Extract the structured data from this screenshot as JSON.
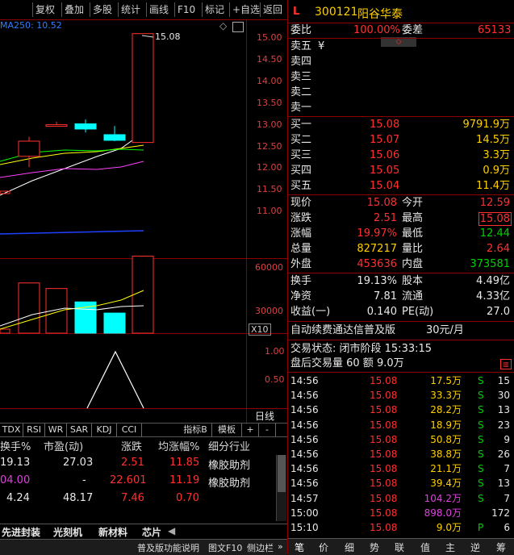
{
  "toolbar": {
    "items": [
      "复权",
      "叠加",
      "多股",
      "统计",
      "画线",
      "F10",
      "标记",
      "+自选",
      "返回"
    ]
  },
  "chart": {
    "indicator_label": "MA250: 10.52",
    "last_price_label": "15.08",
    "price_axis": [
      "15.00",
      "14.50",
      "14.00",
      "13.50",
      "13.00",
      "12.50",
      "12.00",
      "11.50",
      "11.00"
    ],
    "volume_axis": [
      "60000",
      "30000"
    ],
    "volume_unit": "X10",
    "osc_axis": [
      "1.00",
      "0.50"
    ],
    "period_label": "日线"
  },
  "chart_data": {
    "type": "candlestick",
    "candles": [
      {
        "open": 12.25,
        "close": 12.6,
        "high": 12.7,
        "low": 12.0
      },
      {
        "open": 12.98,
        "close": 12.98,
        "high": 13.05,
        "low": 12.95
      },
      {
        "open": 13.0,
        "close": 12.88,
        "high": 13.1,
        "low": 12.8
      },
      {
        "open": 12.75,
        "close": 12.62,
        "high": 12.95,
        "low": 12.6
      },
      {
        "open": 12.57,
        "close": 15.08,
        "high": 15.08,
        "low": 12.57
      }
    ],
    "volumes": [
      45000,
      40000,
      28000,
      18000,
      69000
    ],
    "osc": [
      0,
      1.0,
      0
    ]
  },
  "indicator_tabs": [
    "TDX",
    "RSI",
    "WR",
    "SAR",
    "KDJ",
    "CCI",
    "指标B",
    "模板",
    "+",
    "-"
  ],
  "table": {
    "headers": [
      "换手%",
      "市盈(动)",
      "涨跌",
      "均涨幅%",
      "细分行业"
    ],
    "rows": [
      [
        "19.13",
        "27.03",
        "2.51",
        "11.85",
        "橡胶助剂"
      ],
      [
        "04.00",
        "-",
        "22.601",
        "11.19",
        "橡胶助剂"
      ],
      [
        "4.24",
        "48.17",
        "7.46",
        "0.70",
        ""
      ]
    ]
  },
  "bottom_tabs": [
    "先进封装",
    "光刻机",
    "新材料",
    "芯片"
  ],
  "status_bar": {
    "left": "普及版功能说明",
    "items": [
      "图文F10",
      "侧边栏",
      "»"
    ]
  },
  "quote": {
    "flag": "L",
    "code": "300121",
    "name": "阳谷华泰",
    "weibi_label": "委比",
    "weibi_value": "100.00%",
    "weicha_label": "委差",
    "weicha_value": "65133",
    "asks": [
      {
        "label": "卖五",
        "price": "¥",
        "vol": ""
      },
      {
        "label": "卖四",
        "price": "",
        "vol": ""
      },
      {
        "label": "卖三",
        "price": "",
        "vol": ""
      },
      {
        "label": "卖二",
        "price": "",
        "vol": ""
      },
      {
        "label": "卖一",
        "price": "",
        "vol": ""
      }
    ],
    "bids": [
      {
        "label": "买一",
        "price": "15.08",
        "vol": "9791.9万"
      },
      {
        "label": "买二",
        "price": "15.07",
        "vol": "14.5万"
      },
      {
        "label": "买三",
        "price": "15.06",
        "vol": "3.3万"
      },
      {
        "label": "买四",
        "price": "15.05",
        "vol": "0.9万"
      },
      {
        "label": "买五",
        "price": "15.04",
        "vol": "11.4万"
      }
    ],
    "stats": [
      {
        "l1": "现价",
        "v1": "15.08",
        "l2": "今开",
        "v2": "12.59"
      },
      {
        "l1": "涨跌",
        "v1": "2.51",
        "l2": "最高",
        "v2": "15.08"
      },
      {
        "l1": "涨幅",
        "v1": "19.97%",
        "l2": "最低",
        "v2": "12.44"
      },
      {
        "l1": "总量",
        "v1": "827217",
        "l2": "量比",
        "v2": "2.64"
      },
      {
        "l1": "外盘",
        "v1": "453636",
        "l2": "内盘",
        "v2": "373581"
      }
    ],
    "stats2": [
      {
        "l1": "换手",
        "v1": "19.13%",
        "l2": "股本",
        "v2": "4.49亿"
      },
      {
        "l1": "净资",
        "v1": "7.81",
        "l2": "流通",
        "v2": "4.33亿"
      },
      {
        "l1": "收益(一)",
        "v1": "0.140",
        "l2": "PE(动)",
        "v2": "27.0"
      }
    ],
    "promo": "自动续费通达信普及版",
    "promo_price": "30元/月",
    "trade_status": "交易状态: 闭市阶段 15:33:15",
    "after_hours": "盘后交易量 60 额 9.0万",
    "ticks": [
      {
        "t": "14:56",
        "p": "15.08",
        "v": "17.5万",
        "s": "S",
        "n": "15"
      },
      {
        "t": "14:56",
        "p": "15.08",
        "v": "33.3万",
        "s": "S",
        "n": "30"
      },
      {
        "t": "14:56",
        "p": "15.08",
        "v": "28.2万",
        "s": "S",
        "n": "13"
      },
      {
        "t": "14:56",
        "p": "15.08",
        "v": "18.9万",
        "s": "S",
        "n": "23"
      },
      {
        "t": "14:56",
        "p": "15.08",
        "v": "50.8万",
        "s": "S",
        "n": "9"
      },
      {
        "t": "14:56",
        "p": "15.08",
        "v": "38.8万",
        "s": "S",
        "n": "26"
      },
      {
        "t": "14:56",
        "p": "15.08",
        "v": "21.1万",
        "s": "S",
        "n": "7"
      },
      {
        "t": "14:56",
        "p": "15.08",
        "v": "39.4万",
        "s": "S",
        "n": "13"
      },
      {
        "t": "14:57",
        "p": "15.08",
        "v": "104.2万",
        "s": "S",
        "n": "7"
      },
      {
        "t": "15:00",
        "p": "15.08",
        "v": "898.0万",
        "s": "",
        "n": "172"
      },
      {
        "t": "15:10",
        "p": "15.08",
        "v": "9.0万",
        "s": "P",
        "n": "6"
      }
    ],
    "bottom_tabs": [
      "笔",
      "价",
      "细",
      "势",
      "联",
      "值",
      "主",
      "逆",
      "筹"
    ]
  }
}
